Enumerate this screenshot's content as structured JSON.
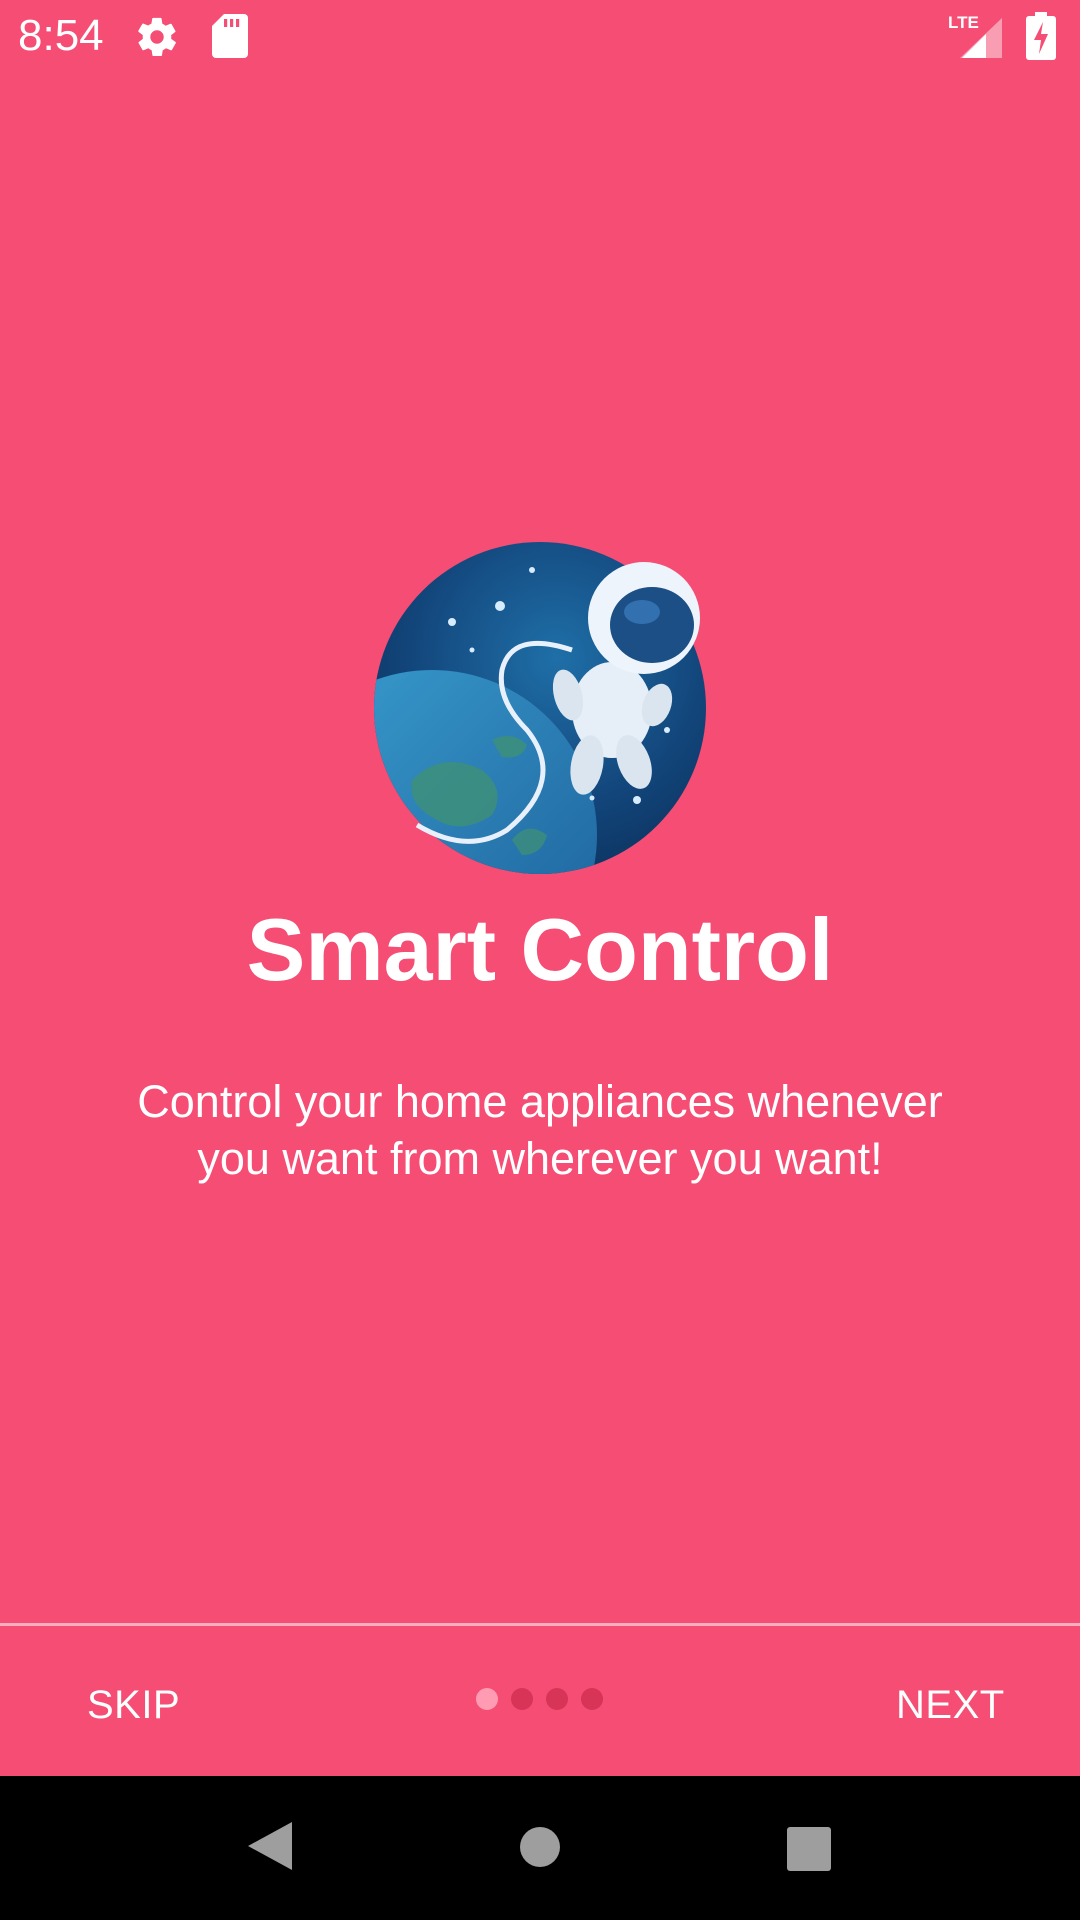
{
  "status_bar": {
    "time": "8:54",
    "icons": [
      "gear-icon",
      "sd-card-icon",
      "lte-signal-icon",
      "battery-charging-icon"
    ],
    "network_label": "LTE"
  },
  "onboarding": {
    "hero_icon": "astronaut-earth-illustration",
    "title": "Smart Control",
    "description": "Control your home appliances whenever you want from wherever you want!"
  },
  "bottom_bar": {
    "skip_label": "SKIP",
    "next_label": "NEXT",
    "page_count": 4,
    "active_page": 1
  },
  "system_nav": {
    "icons": [
      "back-icon",
      "home-icon",
      "recents-icon"
    ]
  },
  "colors": {
    "background": "#f54d73",
    "dot_active": "#ff9cb3",
    "dot_inactive": "#d73458",
    "nav_bar": "#000000"
  }
}
